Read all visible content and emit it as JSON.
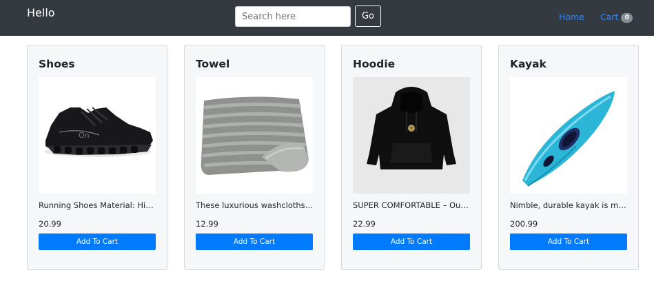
{
  "navbar": {
    "brand": "Hello",
    "search_placeholder": "Search here",
    "go_label": "Go",
    "home_label": "Home",
    "cart_label": "Cart",
    "cart_count": "0"
  },
  "colors": {
    "navbar_bg": "#343a40",
    "link": "#2f86f3",
    "primary_button": "#007bff",
    "card_bg": "#f6f7f9"
  },
  "products": [
    {
      "title": "Shoes",
      "description": "Running Shoes Material: High-quality materials",
      "price": "20.99",
      "button_label": "Add To Cart",
      "image_icon": "shoe-image"
    },
    {
      "title": "Towel",
      "description": "These luxurious washcloths are soft and absorbent",
      "price": "12.99",
      "button_label": "Add To Cart",
      "image_icon": "towel-image"
    },
    {
      "title": "Hoodie",
      "description": "SUPER COMFORTABLE – Our hoodie is made of soft fabric",
      "price": "22.99",
      "button_label": "Add To Cart",
      "image_icon": "hoodie-image"
    },
    {
      "title": "Kayak",
      "description": "Nimble, durable kayak is made for paddling",
      "price": "200.99",
      "button_label": "Add To Cart",
      "image_icon": "kayak-image"
    }
  ]
}
